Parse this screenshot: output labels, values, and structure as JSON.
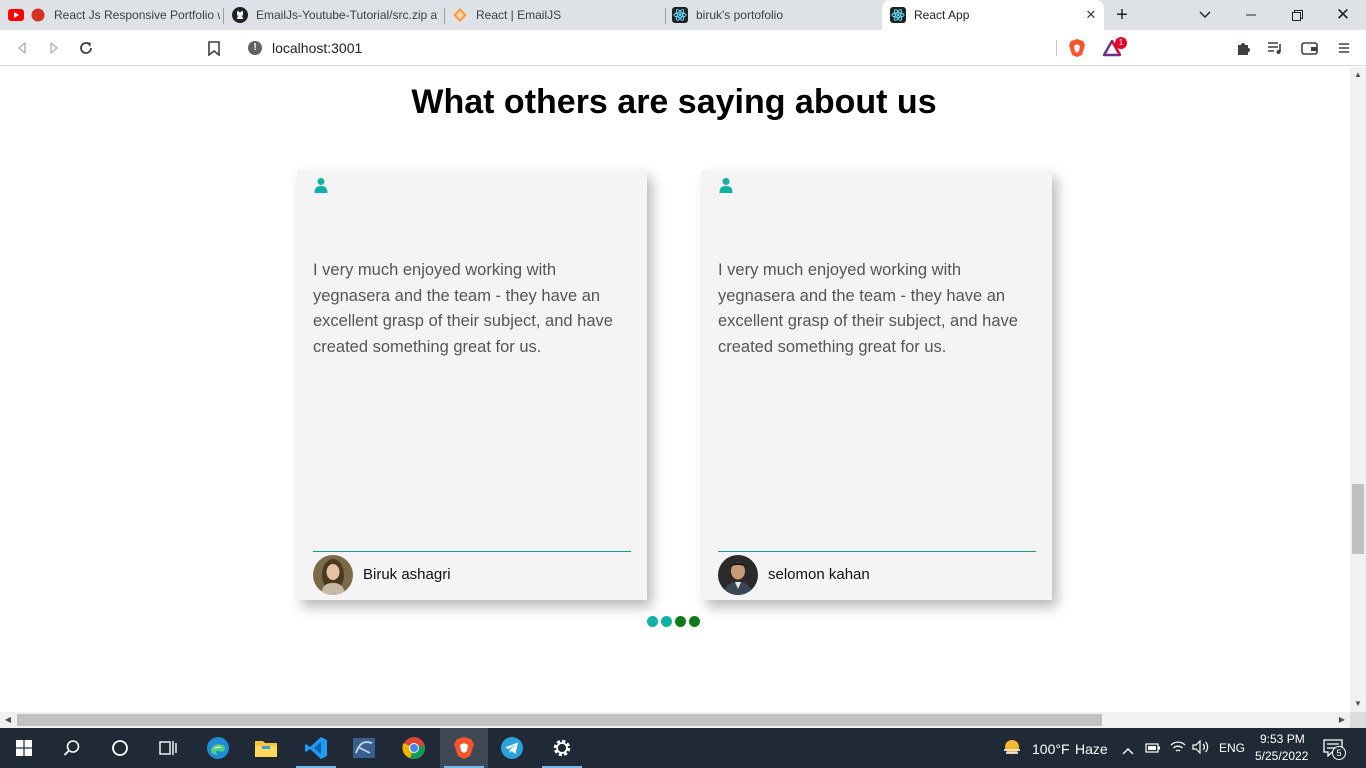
{
  "browser": {
    "tabs": [
      {
        "label": "React Js Responsive Portfolio w",
        "icon": "youtube-icon",
        "active": false
      },
      {
        "label": "EmailJs-Youtube-Tutorial/src.zip at",
        "icon": "github-icon",
        "active": false
      },
      {
        "label": "React | EmailJS",
        "icon": "emailjs-icon",
        "active": false
      },
      {
        "label": "biruk's portofolio",
        "icon": "react-icon",
        "active": false
      },
      {
        "label": "React App",
        "icon": "react-icon",
        "active": true
      }
    ],
    "url": "localhost:3001",
    "brave_rewards_badge": "1"
  },
  "page": {
    "heading": "What others are saying about us",
    "testimonials": [
      {
        "quote": "I very much enjoyed working with yegnasera and the team - they have an excellent grasp of their subject, and have created something great for us.",
        "author": "Biruk ashagri"
      },
      {
        "quote": "I very much enjoyed working with yegnasera and the team - they have an excellent grasp of their subject, and have created something great for us.",
        "author": "selomon kahan"
      }
    ],
    "pagination": {
      "total": 4,
      "active_colors": [
        "#10b3a3",
        "#10b3a3",
        "#0e7a1e",
        "#0e7a1e"
      ]
    },
    "accent_color": "#10a192"
  },
  "taskbar": {
    "weather_temp": "100°F",
    "weather_text": "Haze",
    "language": "ENG",
    "time": "9:53 PM",
    "date": "5/25/2022",
    "notification_count": "5"
  }
}
